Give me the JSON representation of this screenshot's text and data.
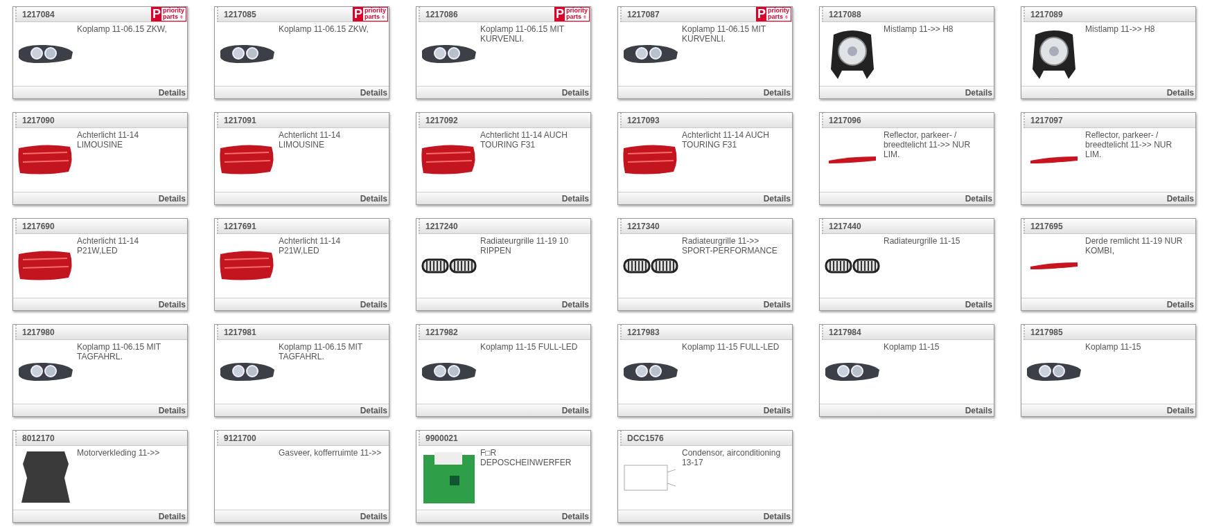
{
  "cards": [
    {
      "code": "1217084",
      "badge": {
        "mark": "P",
        "line1": "priority",
        "line2": "parts",
        "reg": "®"
      },
      "kind": "headlamp",
      "description": "Koplamp 11-06.15 ZKW,",
      "link": "Details"
    },
    {
      "code": "1217085",
      "badge": {
        "mark": "P",
        "line1": "priority",
        "line2": "parts",
        "reg": "®"
      },
      "kind": "headlamp",
      "description": "Koplamp 11-06.15 ZKW,",
      "link": "Details"
    },
    {
      "code": "1217086",
      "badge": {
        "mark": "P",
        "line1": "priority",
        "line2": "parts",
        "reg": "®"
      },
      "kind": "headlamp",
      "description": "Koplamp 11-06.15 MIT KURVENLI.",
      "link": "Details"
    },
    {
      "code": "1217087",
      "badge": {
        "mark": "P",
        "line1": "priority",
        "line2": "parts",
        "reg": "®"
      },
      "kind": "headlamp",
      "description": "Koplamp 11-06.15 MIT KURVENLI.",
      "link": "Details"
    },
    {
      "code": "1217088",
      "kind": "foglamp",
      "description": "Mistlamp 11->> H8",
      "link": "Details"
    },
    {
      "code": "1217089",
      "kind": "foglamp",
      "description": "Mistlamp 11->> H8",
      "link": "Details"
    },
    {
      "code": "1217090",
      "kind": "taillight",
      "description": "Achterlicht 11-14 LIMOUSINE",
      "link": "Details"
    },
    {
      "code": "1217091",
      "kind": "taillight",
      "description": "Achterlicht 11-14 LIMOUSINE",
      "link": "Details"
    },
    {
      "code": "1217092",
      "kind": "taillight",
      "description": "Achterlicht 11-14 AUCH TOURING F31",
      "link": "Details"
    },
    {
      "code": "1217093",
      "kind": "taillight",
      "description": "Achterlicht 11-14 AUCH TOURING F31",
      "link": "Details"
    },
    {
      "code": "1217096",
      "kind": "reflector",
      "description": "Reflector, parkeer- / breedtelicht 11->> NUR LIM.",
      "link": "Details"
    },
    {
      "code": "1217097",
      "kind": "reflector",
      "description": "Reflector, parkeer- / breedtelicht 11->> NUR LIM.",
      "link": "Details"
    },
    {
      "code": "1217690",
      "kind": "taillight",
      "description": "Achterlicht 11-14 P21W,LED",
      "link": "Details"
    },
    {
      "code": "1217691",
      "kind": "taillight",
      "description": "Achterlicht 11-14 P21W,LED",
      "link": "Details"
    },
    {
      "code": "1217240",
      "kind": "grille",
      "description": "Radiateurgrille 11-19 10 RIPPEN",
      "link": "Details"
    },
    {
      "code": "1217340",
      "kind": "grille",
      "description": "Radiateurgrille 11->> SPORT-PERFORMANCE",
      "link": "Details"
    },
    {
      "code": "1217440",
      "kind": "grille",
      "description": "Radiateurgrille 11-15",
      "link": "Details"
    },
    {
      "code": "1217695",
      "kind": "reflector",
      "description": "Derde remlicht 11-19 NUR KOMBI,",
      "link": "Details"
    },
    {
      "code": "1217980",
      "kind": "headlamp",
      "description": "Koplamp 11-06.15 MIT TAGFAHRL.",
      "link": "Details"
    },
    {
      "code": "1217981",
      "kind": "headlamp",
      "description": "Koplamp 11-06.15 MIT TAGFAHRL.",
      "link": "Details"
    },
    {
      "code": "1217982",
      "kind": "headlamp",
      "description": "Koplamp 11-15 FULL-LED",
      "link": "Details"
    },
    {
      "code": "1217983",
      "kind": "headlamp",
      "description": "Koplamp 11-15 FULL-LED",
      "link": "Details"
    },
    {
      "code": "1217984",
      "kind": "headlamp",
      "description": "Koplamp 11-15",
      "link": "Details"
    },
    {
      "code": "1217985",
      "kind": "headlamp",
      "description": "Koplamp 11-15",
      "link": "Details"
    },
    {
      "code": "8012170",
      "kind": "panel",
      "description": "Motorverkleding 11->>",
      "link": "Details"
    },
    {
      "code": "9121700",
      "kind": "none",
      "description": "Gasveer, kofferruimte 11->>",
      "link": "Details"
    },
    {
      "code": "9900021",
      "kind": "circuit",
      "description": "F□R DEPOSCHEINWERFER",
      "link": "Details"
    },
    {
      "code": "DCC1576",
      "kind": "diagram",
      "description": "Condensor, airconditioning 13-17",
      "link": "Details"
    }
  ]
}
